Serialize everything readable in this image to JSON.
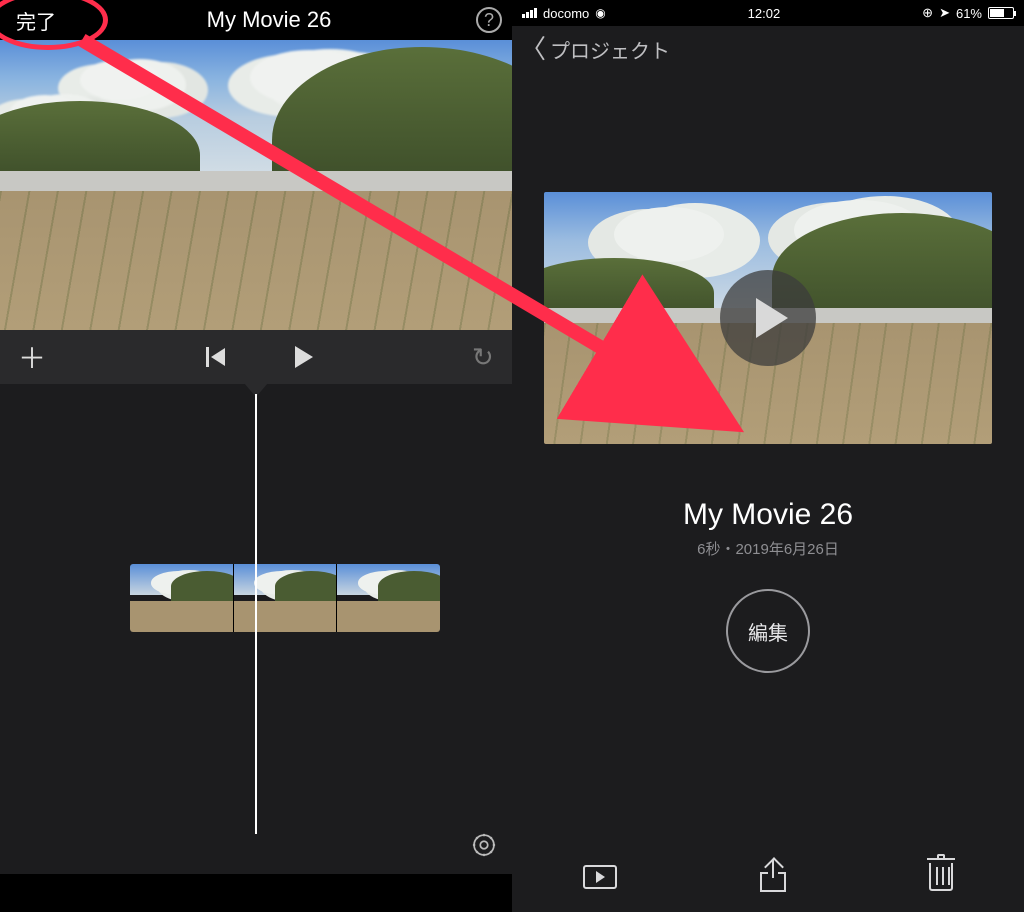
{
  "left": {
    "done_label": "完了",
    "title": "My Movie 26",
    "help_label": "?"
  },
  "right": {
    "status": {
      "carrier": "docomo",
      "time": "12:02",
      "battery_pct": "61%"
    },
    "nav_back_label": "プロジェクト",
    "project_title": "My Movie 26",
    "project_sub": "6秒・2019年6月26日",
    "edit_label": "編集"
  },
  "icons": {
    "plus": "＋",
    "undo": "↺",
    "wifi": "⌔"
  }
}
